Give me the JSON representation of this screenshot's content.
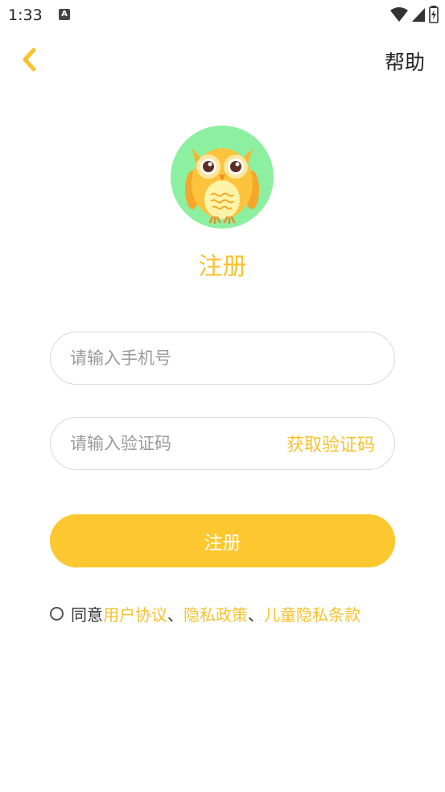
{
  "status_bar": {
    "time": "1:33",
    "notification_badge": "A"
  },
  "header": {
    "back_icon": "chevron-left-icon",
    "help_label": "帮助"
  },
  "logo": {
    "icon": "owl-icon",
    "bg_color": "#8cf0a0"
  },
  "page": {
    "title": "注册"
  },
  "form": {
    "phone_placeholder": "请输入手机号",
    "phone_value": "",
    "code_placeholder": "请输入验证码",
    "code_value": "",
    "get_code_label": "获取验证码",
    "submit_label": "注册"
  },
  "agreement": {
    "prefix": "同意",
    "links": [
      "用户协议",
      "隐私政策",
      "儿童隐私条款"
    ],
    "separator": "、",
    "checked": false
  },
  "colors": {
    "accent": "#f8c22e",
    "button": "#fdc82f"
  }
}
